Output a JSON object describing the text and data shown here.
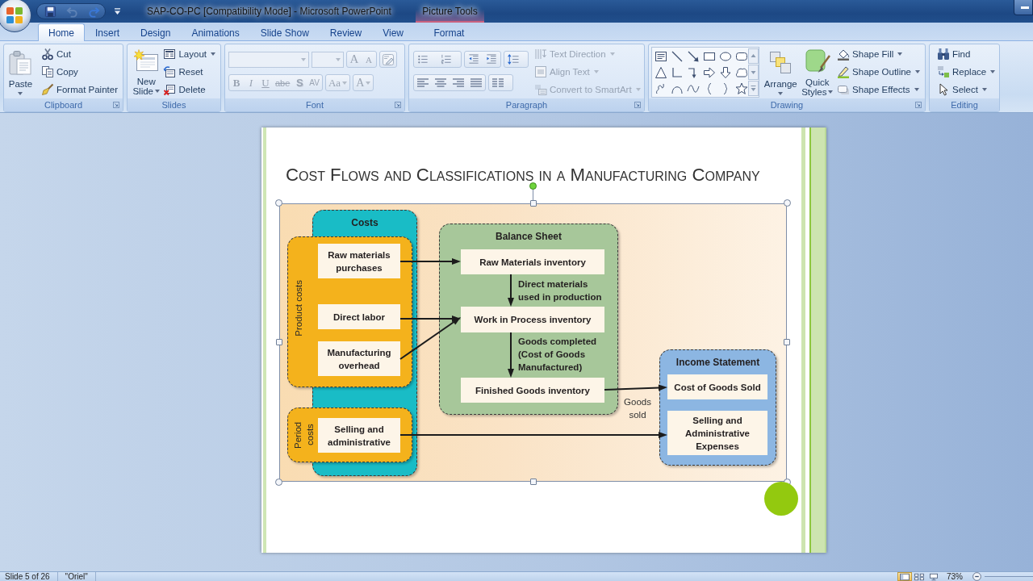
{
  "window": {
    "title": "SAP-CO-PC [Compatibility Mode] - Microsoft PowerPoint"
  },
  "quick_access": [
    {
      "kind": "save",
      "disabled": false
    },
    {
      "kind": "undo",
      "disabled": true
    },
    {
      "kind": "redo",
      "disabled": false
    }
  ],
  "picture_tools": {
    "label": "Picture Tools",
    "tabs": [
      {
        "label": "Format",
        "selected": false
      }
    ]
  },
  "tabs": [
    {
      "label": "Home",
      "selected": true
    },
    {
      "label": "Insert",
      "selected": false
    },
    {
      "label": "Design",
      "selected": false
    },
    {
      "label": "Animations",
      "selected": false
    },
    {
      "label": "Slide Show",
      "selected": false
    },
    {
      "label": "Review",
      "selected": false
    },
    {
      "label": "View",
      "selected": false
    }
  ],
  "ribbon": {
    "clipboard": {
      "label": "Clipboard",
      "paste": "Paste",
      "commands": [
        "Cut",
        "Copy",
        "Format Painter"
      ]
    },
    "slides": {
      "label": "Slides",
      "new_slide": "New Slide",
      "commands": [
        {
          "label": "Layout",
          "dropdown": true
        },
        {
          "label": "Reset",
          "dropdown": false
        },
        {
          "label": "Delete",
          "dropdown": false
        }
      ]
    },
    "font": {
      "label": "Font",
      "disabled": true,
      "size_buttons": [
        "A",
        "A"
      ],
      "format_buttons": [
        "B",
        "I",
        "U",
        "abe",
        "S",
        "AV"
      ],
      "case_button": "Aa",
      "color_button": "A"
    },
    "paragraph": {
      "label": "Paragraph",
      "commands": [
        {
          "label": "Text Direction",
          "disabled": true
        },
        {
          "label": "Align Text",
          "disabled": true
        },
        {
          "label": "Convert to SmartArt",
          "disabled": true
        }
      ]
    },
    "drawing": {
      "label": "Drawing",
      "arrange": "Arrange",
      "quick_styles": "Quick Styles",
      "commands": [
        "Shape Fill",
        "Shape Outline",
        "Shape Effects"
      ]
    },
    "editing": {
      "label": "Editing",
      "commands": [
        {
          "label": "Find",
          "dropdown": false
        },
        {
          "label": "Replace",
          "dropdown": true
        },
        {
          "label": "Select",
          "dropdown": true
        }
      ]
    }
  },
  "slide": {
    "title": "Cost Flows and Classifications in a Manufacturing Company",
    "picture_selected": true,
    "diagram": {
      "costs": {
        "title": "Costs"
      },
      "product_costs": {
        "label": "Product costs",
        "items": [
          "Raw materials purchases",
          "Direct labor",
          "Manufacturing overhead"
        ]
      },
      "period_costs": {
        "label": "Period costs",
        "items": [
          "Selling and administrative"
        ]
      },
      "balance_sheet": {
        "title": "Balance Sheet",
        "items": [
          "Raw Materials inventory",
          "Work in Process inventory",
          "Finished Goods inventory"
        ],
        "flows": [
          "Direct materials used in production",
          "Goods completed (Cost of Goods Manufactured)"
        ]
      },
      "income_statement": {
        "title": "Income Statement",
        "items": [
          "Cost of Goods Sold",
          "Selling and Administrative Expenses"
        ]
      },
      "goods_sold": "Goods sold"
    }
  },
  "status_bar": {
    "slide": "Slide 5 of 26",
    "theme": "\"Oriel\"",
    "views": [
      {
        "kind": "normal",
        "selected": true
      },
      {
        "kind": "sorter",
        "selected": false
      },
      {
        "kind": "show",
        "selected": false
      }
    ],
    "zoom": "73%"
  }
}
